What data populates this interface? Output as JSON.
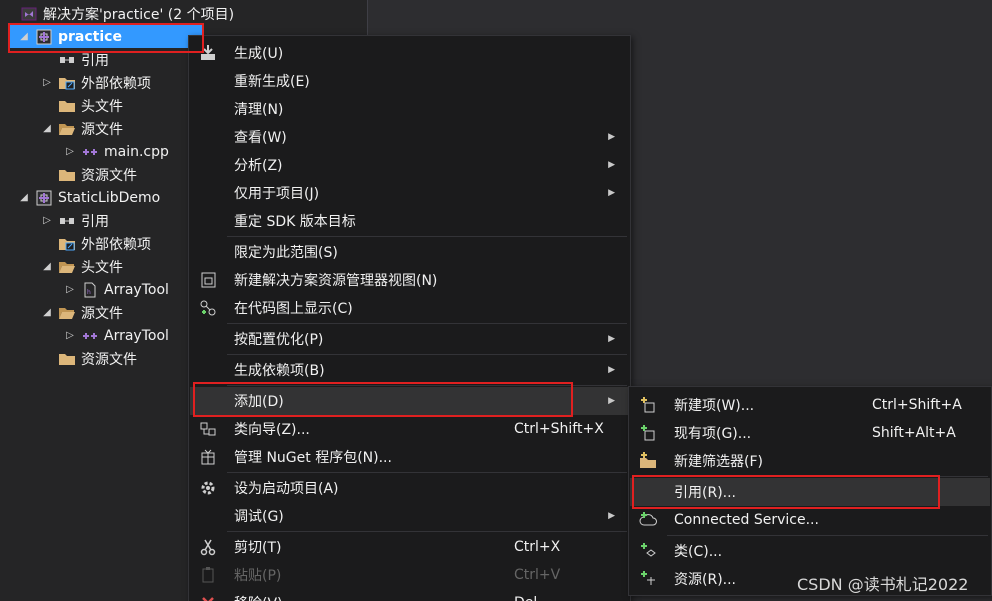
{
  "solution": {
    "title": "解决方案'practice' (2 个项目)",
    "items": [
      {
        "label": "practice",
        "icon": "project-icon",
        "arrow": "expanded",
        "indent": 0,
        "selected": true
      },
      {
        "label": "引用",
        "icon": "references-icon",
        "arrow": "none",
        "indent": 1
      },
      {
        "label": "外部依赖项",
        "icon": "folder-external-icon",
        "arrow": "collapsed",
        "indent": 1
      },
      {
        "label": "头文件",
        "icon": "folder-icon",
        "arrow": "none",
        "indent": 1
      },
      {
        "label": "源文件",
        "icon": "folder-open-icon",
        "arrow": "expanded",
        "indent": 1
      },
      {
        "label": "main.cpp",
        "icon": "cpp-file-icon",
        "arrow": "collapsed",
        "indent": 2
      },
      {
        "label": "资源文件",
        "icon": "folder-icon",
        "arrow": "none",
        "indent": 1
      },
      {
        "label": "StaticLibDemo",
        "icon": "project-icon",
        "arrow": "expanded",
        "indent": 0
      },
      {
        "label": "引用",
        "icon": "references-icon",
        "arrow": "collapsed",
        "indent": 1
      },
      {
        "label": "外部依赖项",
        "icon": "folder-external-icon",
        "arrow": "none",
        "indent": 1
      },
      {
        "label": "头文件",
        "icon": "folder-open-icon",
        "arrow": "expanded",
        "indent": 1
      },
      {
        "label": "ArrayTool",
        "icon": "header-file-icon",
        "arrow": "collapsed",
        "indent": 2
      },
      {
        "label": "源文件",
        "icon": "folder-open-icon",
        "arrow": "expanded",
        "indent": 1
      },
      {
        "label": "ArrayTool",
        "icon": "cpp-file-icon",
        "arrow": "collapsed",
        "indent": 2
      },
      {
        "label": "资源文件",
        "icon": "folder-icon",
        "arrow": "none",
        "indent": 1
      }
    ]
  },
  "context_menu": {
    "items": [
      {
        "label": "生成(U)",
        "icon": "build-icon"
      },
      {
        "label": "重新生成(E)"
      },
      {
        "label": "清理(N)"
      },
      {
        "label": "查看(W)",
        "submenu": true
      },
      {
        "label": "分析(Z)",
        "submenu": true
      },
      {
        "label": "仅用于项目(J)",
        "submenu": true
      },
      {
        "label": "重定 SDK 版本目标"
      },
      {
        "separator": true
      },
      {
        "label": "限定为此范围(S)"
      },
      {
        "label": "新建解决方案资源管理器视图(N)",
        "icon": "new-view-icon"
      },
      {
        "label": "在代码图上显示(C)",
        "icon": "code-map-icon"
      },
      {
        "separator": true
      },
      {
        "label": "按配置优化(P)",
        "submenu": true
      },
      {
        "separator": true
      },
      {
        "label": "生成依赖项(B)",
        "submenu": true
      },
      {
        "separator": true
      },
      {
        "label": "添加(D)",
        "submenu": true,
        "highlighted": true
      },
      {
        "label": "类向导(Z)...",
        "shortcut": "Ctrl+Shift+X",
        "icon": "class-wizard-icon"
      },
      {
        "label": "管理 NuGet 程序包(N)...",
        "icon": "nuget-icon"
      },
      {
        "separator": true
      },
      {
        "label": "设为启动项目(A)",
        "icon": "gear-icon"
      },
      {
        "label": "调试(G)",
        "submenu": true
      },
      {
        "separator": true
      },
      {
        "label": "剪切(T)",
        "shortcut": "Ctrl+X",
        "icon": "scissors-icon"
      },
      {
        "label": "粘贴(P)",
        "shortcut": "Ctrl+V",
        "icon": "paste-icon",
        "disabled": true
      },
      {
        "label": "移除(V)",
        "shortcut": "Del",
        "icon": "remove-icon"
      }
    ]
  },
  "add_submenu": {
    "items": [
      {
        "label": "新建项(W)...",
        "shortcut": "Ctrl+Shift+A",
        "icon": "new-item-icon"
      },
      {
        "label": "现有项(G)...",
        "shortcut": "Shift+Alt+A",
        "icon": "existing-item-icon"
      },
      {
        "label": "新建筛选器(F)",
        "icon": "new-filter-icon"
      },
      {
        "separator": true
      },
      {
        "label": "引用(R)...",
        "highlighted": true
      },
      {
        "label": "Connected Service...",
        "icon": "connected-service-icon"
      },
      {
        "separator": true
      },
      {
        "label": "类(C)...",
        "icon": "add-class-icon"
      },
      {
        "label": "资源(R)...",
        "icon": "add-resource-icon"
      }
    ]
  },
  "watermark": "CSDN @读书札记2022",
  "colors": {
    "selection": "#3399ff",
    "highlight_box": "#e02020",
    "menu_bg": "#1b1b1c",
    "project_icon": "#a277d6",
    "folder": "#dcb67a"
  }
}
